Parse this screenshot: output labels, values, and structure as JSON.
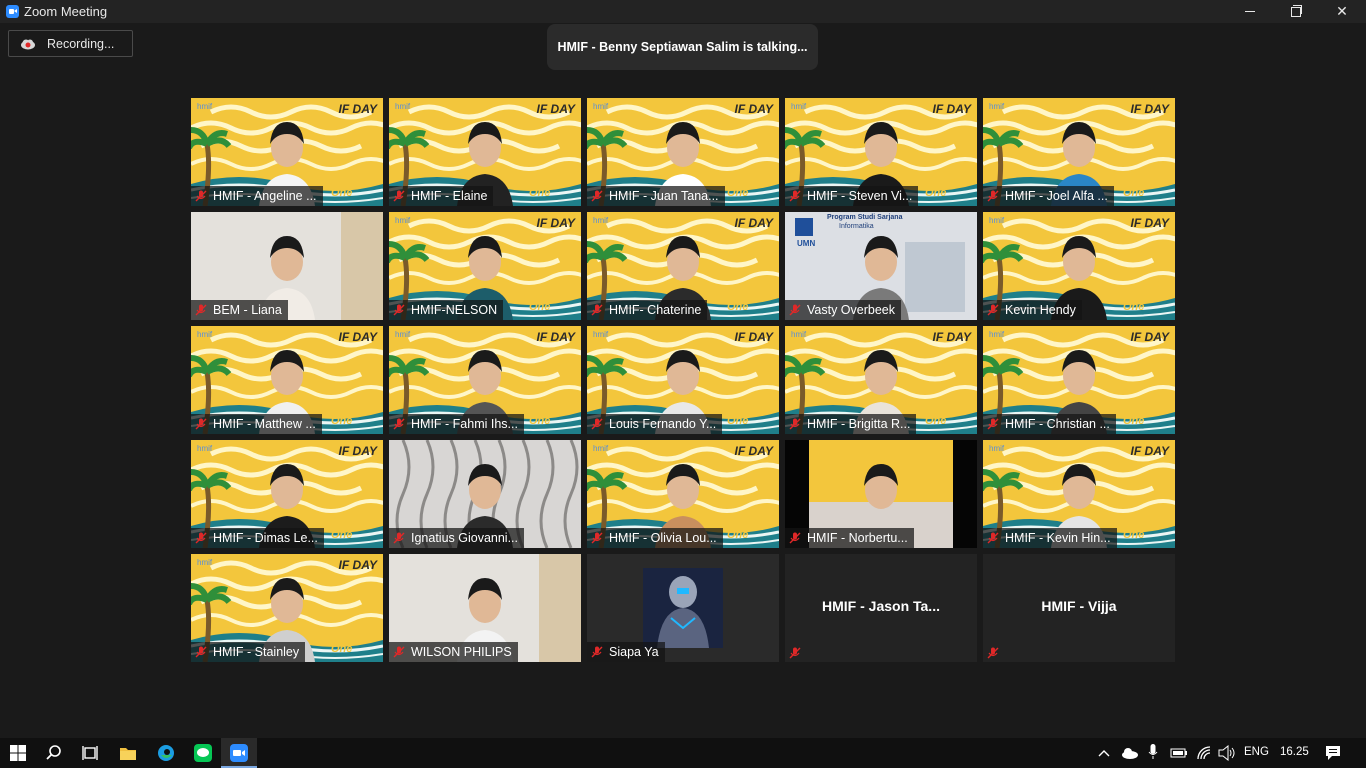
{
  "window": {
    "title": "Zoom Meeting"
  },
  "recording": {
    "label": "Recording..."
  },
  "banner": {
    "talking": "HMIF - Benny Septiawan Salim is talking..."
  },
  "tiles": [
    {
      "name": "HMIF - Angeline ...",
      "style": "ifday"
    },
    {
      "name": "HMIF - Elaine",
      "style": "ifday"
    },
    {
      "name": "HMIF - Juan Tana...",
      "style": "ifday"
    },
    {
      "name": "HMIF - Steven Vi...",
      "style": "ifday"
    },
    {
      "name": "HMIF - Joel Alfa ...",
      "style": "ifday"
    },
    {
      "name": "BEM - Liana",
      "style": "room"
    },
    {
      "name": "HMIF-NELSON",
      "style": "ifday"
    },
    {
      "name": "HMIF- Chaterine",
      "style": "ifday"
    },
    {
      "name": "Vasty Overbeek",
      "style": "umn"
    },
    {
      "name": "Kevin Hendy",
      "style": "ifday"
    },
    {
      "name": "HMIF - Matthew ...",
      "style": "ifday"
    },
    {
      "name": "HMIF - Fahmi Ihs...",
      "style": "ifday"
    },
    {
      "name": "Louis Fernando Y...",
      "style": "ifday"
    },
    {
      "name": "HMIF - Brigitta R...",
      "style": "ifday"
    },
    {
      "name": "HMIF - Christian ...",
      "style": "ifday"
    },
    {
      "name": "HMIF - Dimas Le...",
      "style": "ifday"
    },
    {
      "name": "Ignatius Giovanni...",
      "style": "wallpaper"
    },
    {
      "name": "HMIF - Olivia Lou...",
      "style": "ifday"
    },
    {
      "name": "HMIF - Norbertu...",
      "style": "dark"
    },
    {
      "name": "HMIF - Kevin Hin...",
      "style": "ifday"
    },
    {
      "name": "HMIF - Stainley",
      "style": "ifday"
    },
    {
      "name": "WILSON PHILIPS",
      "style": "room"
    },
    {
      "name": "Siapa Ya",
      "style": "avatar"
    },
    {
      "name": "HMIF - Jason Ta...",
      "style": "blank"
    },
    {
      "name": "HMIF - Vijja",
      "style": "blank"
    }
  ],
  "overlay": {
    "ifday": "IF DAY",
    "logo": "hmif",
    "umn_line1": "Program Studi Sarjana",
    "umn_line2": "Informatika",
    "umn_badge": "UMN"
  },
  "taskbar": {
    "language": "ENG",
    "time": "16.25"
  },
  "colors": {
    "accent": "#2d8cff",
    "muted_mic": "#e02828",
    "ifday_yellow": "#f3c63c",
    "ifday_teal": "#1f7f8a"
  }
}
